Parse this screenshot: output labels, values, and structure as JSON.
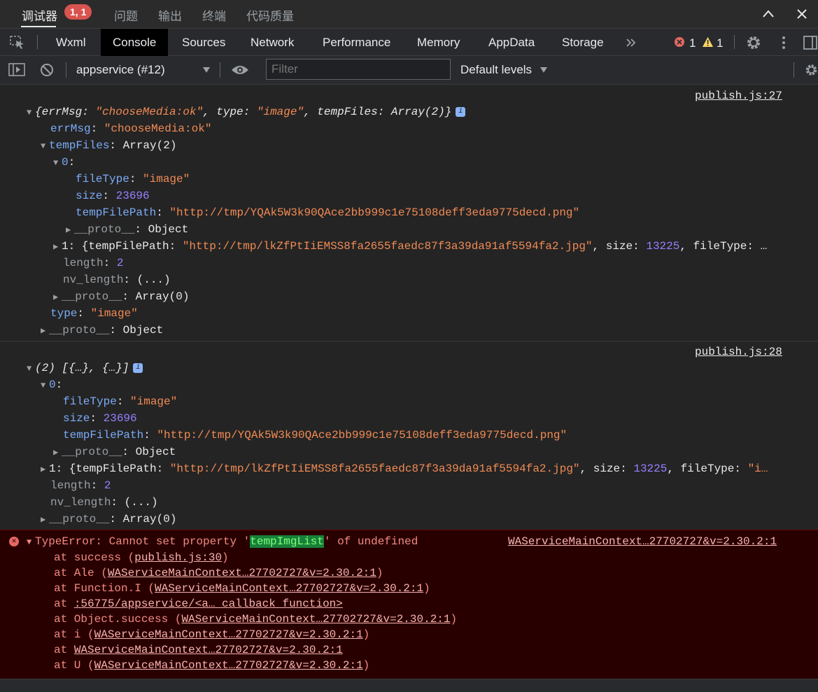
{
  "top_tabs": {
    "debugger": "调试器",
    "badge": "1, 1",
    "problems": "问题",
    "output": "输出",
    "terminal": "终端",
    "code_quality": "代码质量"
  },
  "devtools_tabs": [
    "Wxml",
    "Console",
    "Sources",
    "Network",
    "Performance",
    "Memory",
    "AppData",
    "Storage"
  ],
  "counts": {
    "errors": "1",
    "warnings": "1"
  },
  "toolbar": {
    "context": "appservice (#12)",
    "filter_placeholder": "Filter",
    "levels": "Default levels"
  },
  "log1": {
    "source": "publish.js:27",
    "summary_open": "{",
    "summary_errMsg_key": "errMsg",
    "summary_errMsg_val": "\"chooseMedia:ok\"",
    "summary_type_key": "type",
    "summary_type_val": "\"image\"",
    "summary_tail": "tempFiles: Array(2)}",
    "errMsg_key": "errMsg",
    "errMsg_val": "\"chooseMedia:ok\"",
    "tempFiles_key": "tempFiles",
    "tempFiles_val": "Array(2)",
    "item0_key": "0",
    "fileType_key": "fileType",
    "fileType_val": "\"image\"",
    "size_key": "size",
    "size_val": "23696",
    "path_key": "tempFilePath",
    "path_val": "\"http://tmp/YQAk5W3k90QAce2bb999c1e75108deff3eda9775decd.png\"",
    "proto_key": "__proto__",
    "proto_obj": "Object",
    "item1_prefix": "1: {tempFilePath: ",
    "item1_path": "\"http://tmp/lkZfPtIiEMSS8fa2655faedc87f3a39da91af5594fa2.jpg\"",
    "item1_size_label": ", size: ",
    "item1_size": "13225",
    "item1_tail": ", fileType: …",
    "length_key": "length",
    "length_val": "2",
    "nvlen_key": "nv_length",
    "nvlen_val": "(...)",
    "proto_arr": "Array(0)",
    "type_key": "type",
    "type_val": "\"image\"",
    "proto2_obj": "Object"
  },
  "log2": {
    "source": "publish.js:28",
    "summary": "(2) [{…}, {…}]",
    "item0_key": "0",
    "fileType_key": "fileType",
    "fileType_val": "\"image\"",
    "size_key": "size",
    "size_val": "23696",
    "path_key": "tempFilePath",
    "path_val": "\"http://tmp/YQAk5W3k90QAce2bb999c1e75108deff3eda9775decd.png\"",
    "proto_key": "__proto__",
    "proto_obj": "Object",
    "item1_prefix": "1: {tempFilePath: ",
    "item1_path": "\"http://tmp/lkZfPtIiEMSS8fa2655faedc87f3a39da91af5594fa2.jpg\"",
    "item1_size_label": ", size: ",
    "item1_size": "13225",
    "item1_tail": ", fileType: ",
    "item1_tail_str": "\"i…",
    "length_key": "length",
    "length_val": "2",
    "nvlen_key": "nv_length",
    "nvlen_val": "(...)",
    "proto_arr": "Array(0)"
  },
  "error": {
    "source": "WAServiceMainContext…27702727&v=2.30.2:1",
    "msg_pre": "TypeError: Cannot set property '",
    "msg_hl": "tempImgList",
    "msg_post": "' of undefined",
    "stack": [
      {
        "pre": "at success (",
        "link": "publish.js:30",
        "post": ")"
      },
      {
        "pre": "at Ale (",
        "link": "WAServiceMainContext…27702727&v=2.30.2:1",
        "post": ")"
      },
      {
        "pre": "at Function.I (",
        "link": "WAServiceMainContext…27702727&v=2.30.2:1",
        "post": ")"
      },
      {
        "pre": "at ",
        "link": ":56775/appservice/<a… callback function>",
        "post": ""
      },
      {
        "pre": "at Object.success (",
        "link": "WAServiceMainContext…27702727&v=2.30.2:1",
        "post": ")"
      },
      {
        "pre": "at i (",
        "link": "WAServiceMainContext…27702727&v=2.30.2:1",
        "post": ")"
      },
      {
        "pre": "at ",
        "link": "WAServiceMainContext…27702727&v=2.30.2:1",
        "post": ""
      },
      {
        "pre": "at U (",
        "link": "WAServiceMainContext…27702727&v=2.30.2:1",
        "post": ")"
      }
    ]
  }
}
